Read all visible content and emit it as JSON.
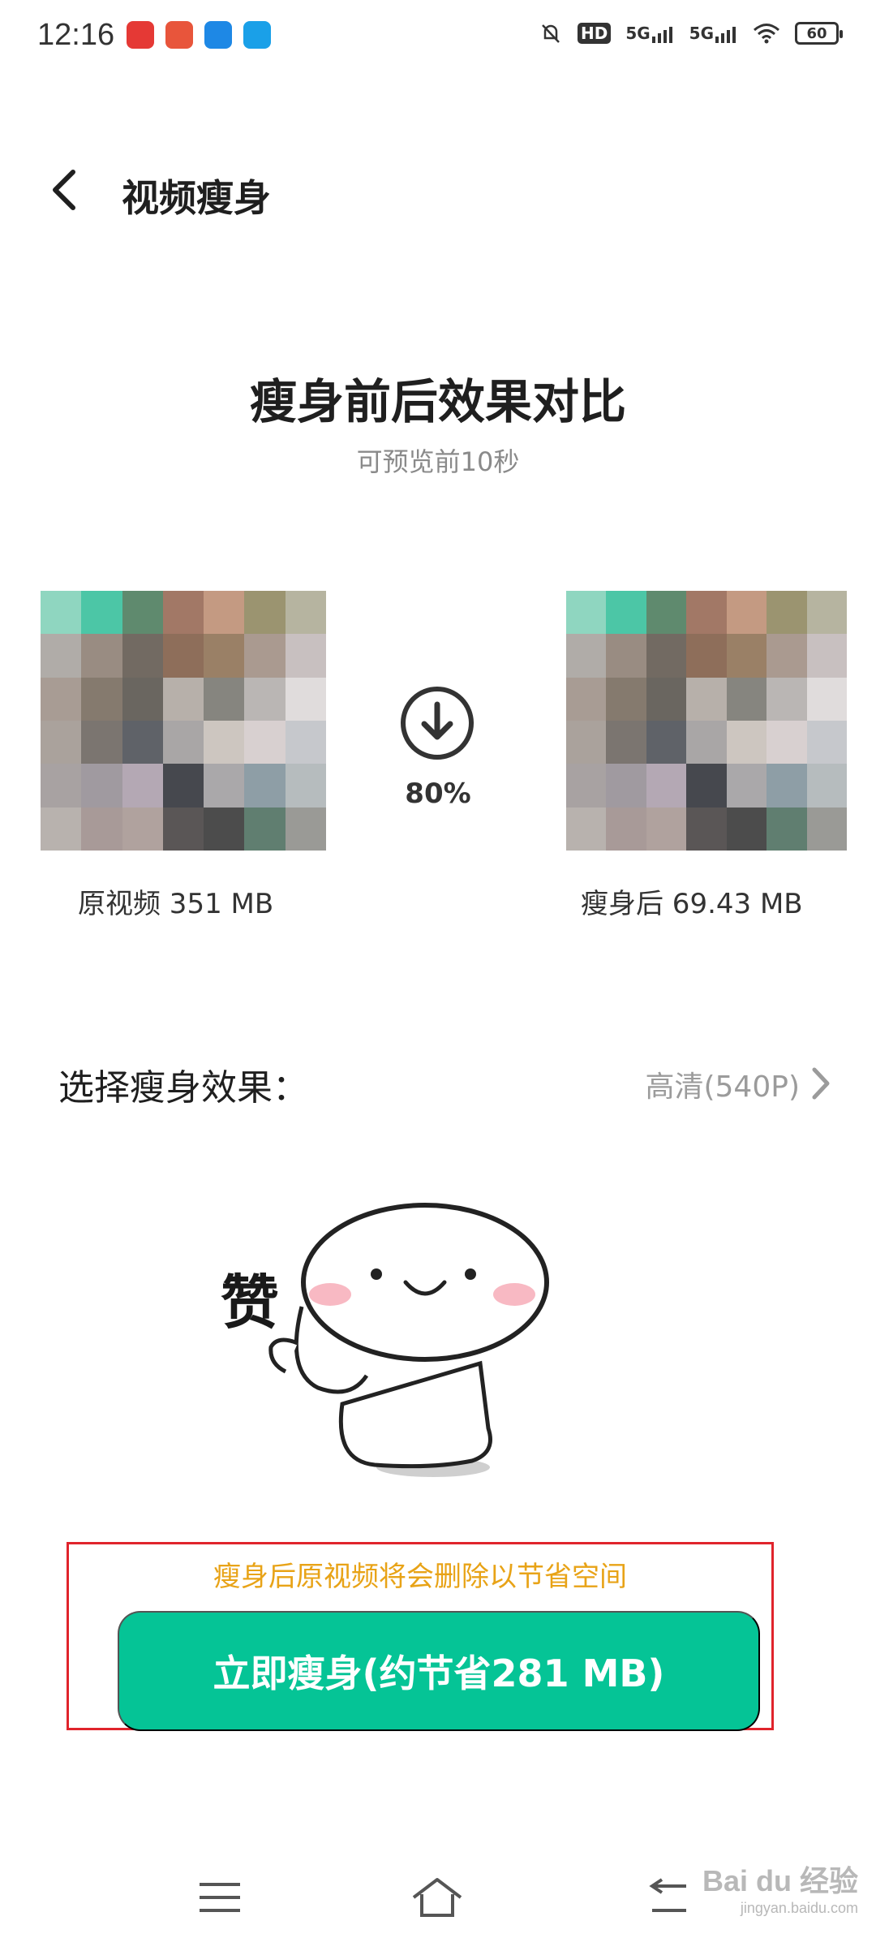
{
  "status_bar": {
    "time": "12:16",
    "signal_1": "5G",
    "signal_2": "5G",
    "hd_label": "HD",
    "battery": "60",
    "app_icon_colors": [
      "#e53935",
      "#e8553b",
      "#1e88e5",
      "#1aa0e8"
    ]
  },
  "header": {
    "title": "视频瘦身"
  },
  "compare": {
    "title": "瘦身前后效果对比",
    "subtitle": "可预览前10秒",
    "original_caption": "原视频 351 MB",
    "slim_caption": "瘦身后 69.43 MB",
    "percent": "80%"
  },
  "thumbnail_colors": [
    "#8fd6c0",
    "#4cc6a6",
    "#5f8a6e",
    "#a27866",
    "#c49a82",
    "#9b9470",
    "#b6b4a0",
    "#b0aca8",
    "#998c82",
    "#726a62",
    "#8e6e5a",
    "#9a8066",
    "#aa9a90",
    "#c8c0c0",
    "#a89c94",
    "#857a6e",
    "#6a6660",
    "#b7b0aa",
    "#86857f",
    "#bab6b4",
    "#e0dcdc",
    "#aaa29c",
    "#7b7570",
    "#5f6268",
    "#a9a6a6",
    "#cdc6c0",
    "#d8d0d0",
    "#c6c8cc",
    "#a8a2a2",
    "#a09aa0",
    "#b4a8b4",
    "#46484e",
    "#aaa8aa",
    "#8e9ea6",
    "#b6bcbe",
    "#b8b2ae",
    "#a89a98",
    "#b0a29e",
    "#5a5656",
    "#4c4c4c",
    "#607e70",
    "#9a9a96"
  ],
  "select": {
    "label": "选择瘦身效果：",
    "value": "高清(540P)"
  },
  "sticker": {
    "text": "赞"
  },
  "action": {
    "notice": "瘦身后原视频将会删除以节省空间",
    "button_label": "立即瘦身(约节省281 MB)",
    "button_color": "#05c496",
    "highlight_color": "#e0242c"
  },
  "watermark": {
    "brand": "Bai du 经验",
    "sub": "jingyan.baidu.com"
  }
}
